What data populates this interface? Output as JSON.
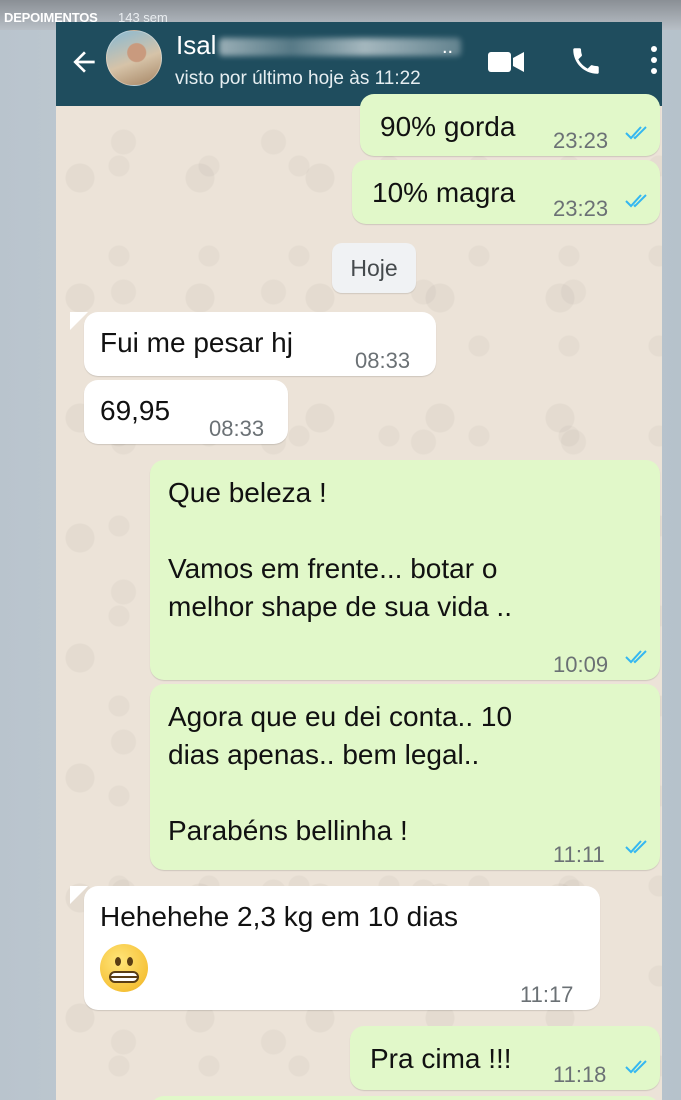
{
  "story": {
    "name": "DEPOIMENTOS",
    "age": "143 sem"
  },
  "header": {
    "contact_name": "Isal",
    "contact_name_suffix": "..",
    "status": "visto por último hoje às 11:22"
  },
  "messages": [
    {
      "direction": "out",
      "text": "90% gorda",
      "time": "23:23",
      "read": true
    },
    {
      "direction": "out",
      "text": "10% magra",
      "time": "23:23",
      "read": true
    },
    {
      "direction": "in",
      "text": "Fui me pesar hj",
      "time": "08:33"
    },
    {
      "direction": "in",
      "text": "69,95",
      "time": "08:33"
    },
    {
      "direction": "out",
      "text": "Que beleza !\n\nVamos em frente... botar o\nmelhor shape de sua vida ..",
      "time": "10:09",
      "read": true
    },
    {
      "direction": "out",
      "text": "Agora que eu dei conta.. 10\ndias apenas.. bem legal..\n\nParabéns bellinha !",
      "time": "11:11",
      "read": true
    },
    {
      "direction": "in",
      "text": "Hehehehe 2,3 kg em 10 dias",
      "emoji": "grimacing-face-emoji",
      "time": "11:17"
    },
    {
      "direction": "out",
      "text": "Pra cima !!!",
      "time": "11:18",
      "read": true
    }
  ],
  "date_divider": "Hoje",
  "colors": {
    "header": "#1f4d5e",
    "outgoing_bubble": "#e1f8c9",
    "incoming_bubble": "#ffffff",
    "read_tick": "#34b7f1",
    "wallpaper": "#ece3d8"
  },
  "icons": [
    "back-arrow-icon",
    "video-call-icon",
    "phone-icon",
    "more-vert-icon",
    "double-check-icon"
  ]
}
